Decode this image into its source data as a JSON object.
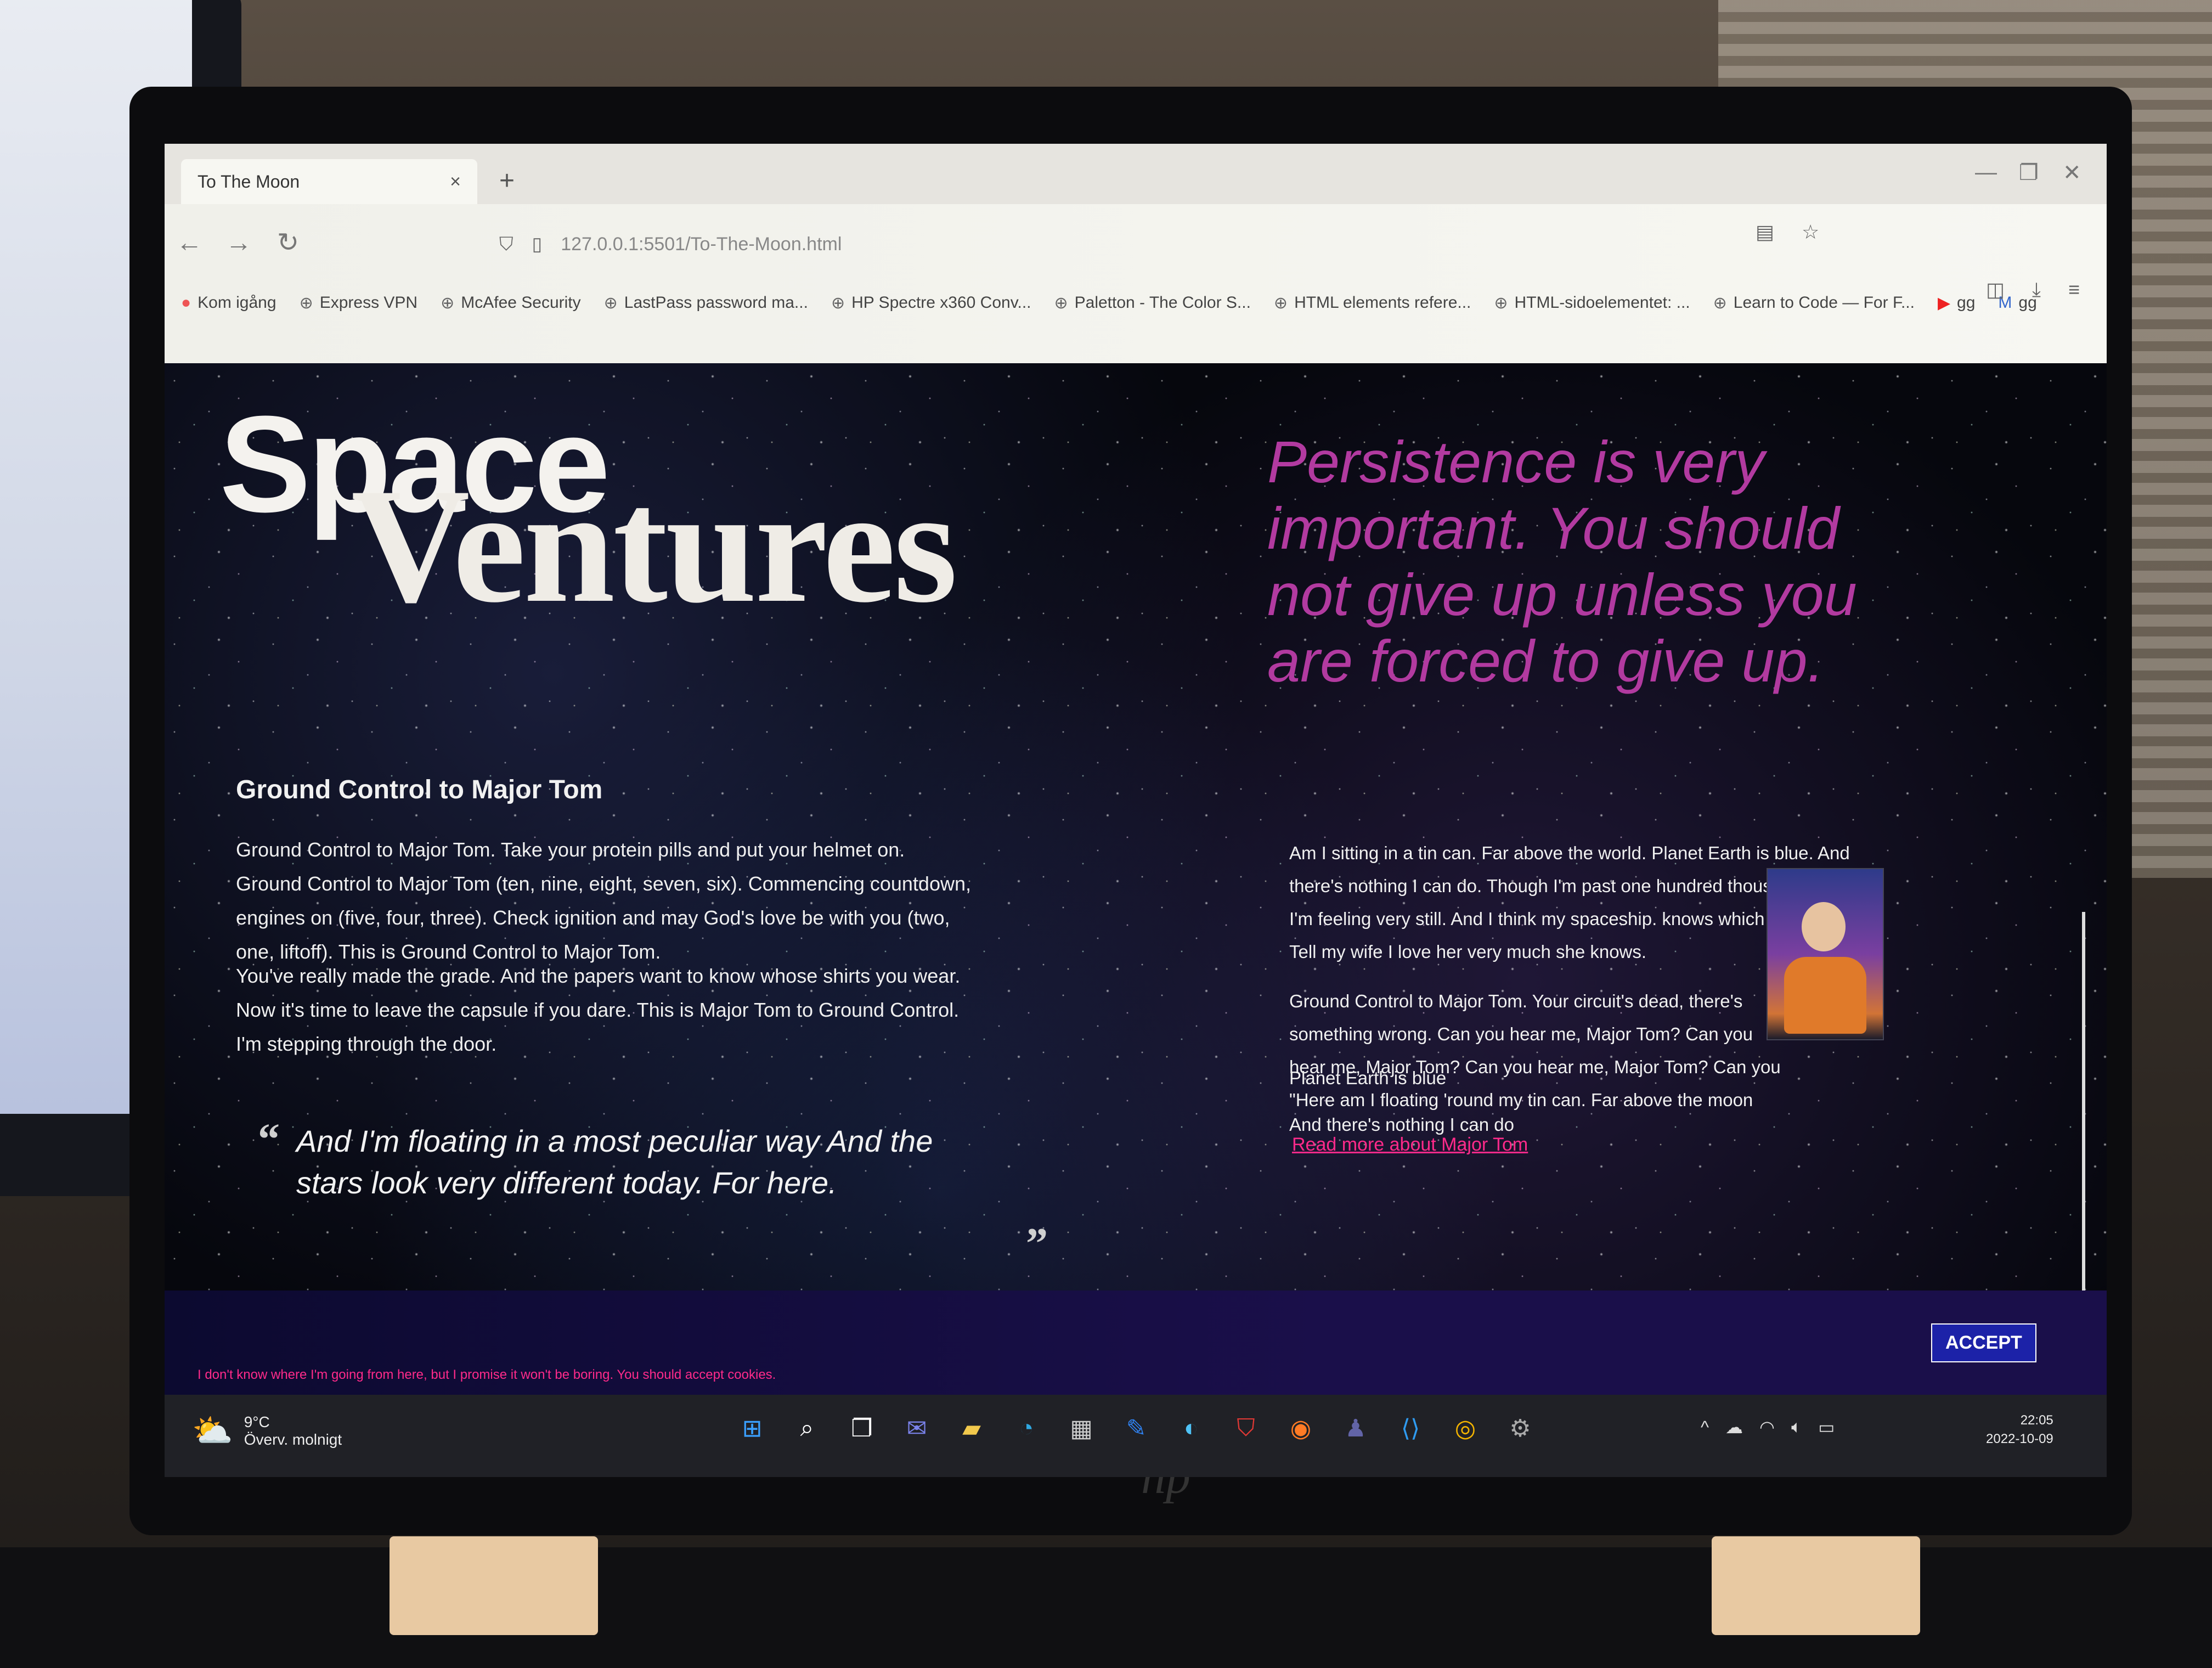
{
  "browser": {
    "tab_title": "To The Moon",
    "tab_close": "×",
    "new_tab": "+",
    "url": "127.0.0.1:5501/To-The-Moon.html",
    "bookmarks": [
      "Kom igång",
      "Express VPN",
      "McAfee Security",
      "LastPass password ma...",
      "HP Spectre x360 Conv...",
      "Paletton - The Color S...",
      "HTML elements refere...",
      "HTML-sidoelementet: ...",
      "Learn to Code — For F...",
      "gg",
      "gg"
    ]
  },
  "page": {
    "title_line1": "Space",
    "title_line2": "Ventures",
    "big_quote": "Persistence is very important. You should not give up unless you are forced to give up.",
    "left_heading": "Ground Control to Major Tom",
    "left_p1": "Ground Control to Major Tom. Take your protein pills and put your helmet on. Ground Control to Major Tom (ten, nine, eight, seven, six). Commencing countdown, engines on (five, four, three). Check ignition and may God's love be with you (two, one, liftoff). This is Ground Control to Major Tom.",
    "left_p2": "You've really made the grade. And the papers want to know whose shirts you wear. Now it's time to leave the capsule if you dare. This is Major Tom to Ground Control. I'm stepping through the door.",
    "blockquote": "And I'm floating in a most peculiar way And the stars look very different today. For here.",
    "right_p1": "Am I sitting in a tin can. Far above the world. Planet Earth is blue. And there's nothing I can do. Though I'm past one hundred thousand miles. I'm feeling very still. And I think my spaceship. knows which way to go. Tell my wife I love her very much she knows.",
    "right_p2": "Ground Control to Major Tom. Your circuit's dead, there's something wrong. Can you hear me, Major Tom? Can you hear me, Major Tom? Can you hear me, Major Tom? Can you \"Here am I floating 'round my tin can. Far above the moon",
    "right_p3": "Planet Earth is blue",
    "right_p4": "And there's nothing I can do",
    "read_more": "Read more about Major Tom",
    "cookie_text": "I don't know where I'm going from here, but I promise it won't be boring. You should accept cookies.",
    "accept_label": "ACCEPT"
  },
  "taskbar": {
    "temperature": "9°C",
    "weather": "Överv. molnigt",
    "time": "22:05",
    "date": "2022-10-09"
  },
  "colors": {
    "accent_pink": "#ff2a8a",
    "quote_magenta": "#b23aa0",
    "accept_blue": "#1c22a8"
  }
}
